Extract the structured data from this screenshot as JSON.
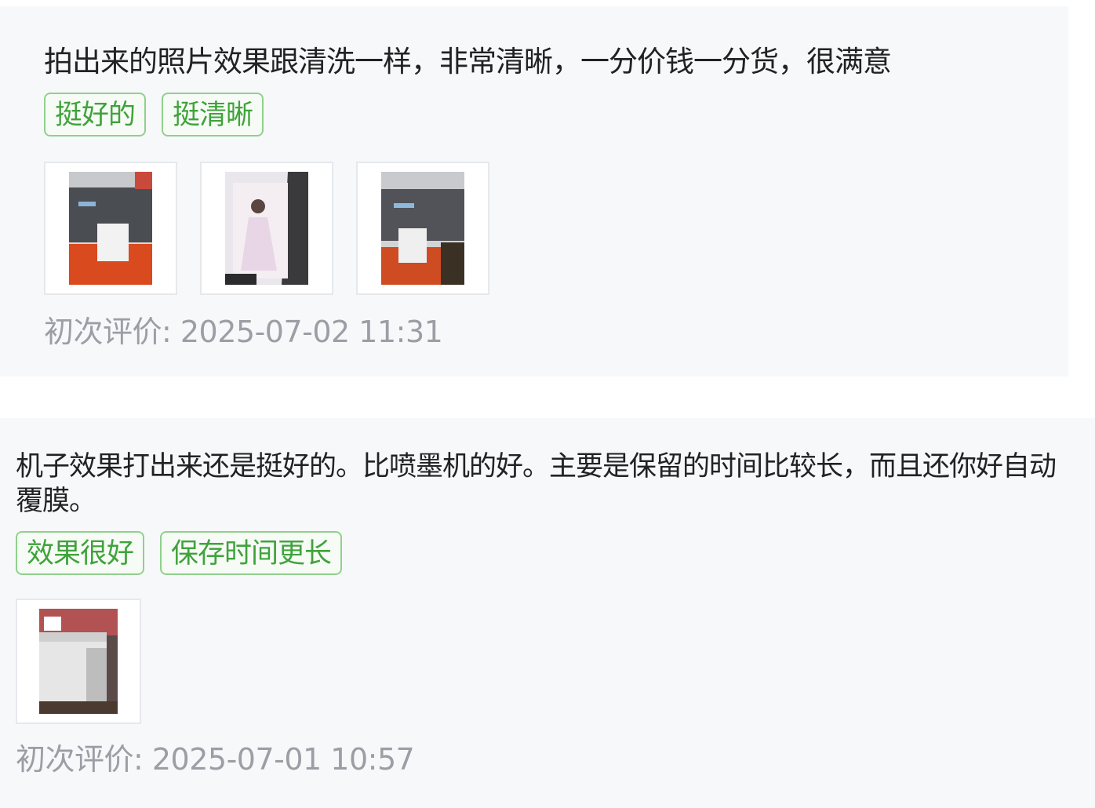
{
  "reviews": [
    {
      "text": "拍出来的照片效果跟清洗一样，非常清晰，一分价钱一分货，很满意",
      "tags": [
        "挺好的",
        "挺清晰"
      ],
      "photo_icons": [
        "printer-photo-icon",
        "portrait-print-photo-icon",
        "printer-photo-icon"
      ],
      "timestamp": "初次评价: 2025-07-02 11:31"
    },
    {
      "text": "机子效果打出来还是挺好的。比喷墨机的好。主要是保留的时间比较长，而且还你好自动覆膜。",
      "tags": [
        "效果很好",
        "保存时间更长"
      ],
      "photo_icons": [
        "printer-photo-icon"
      ],
      "timestamp": "初次评价: 2025-07-01 10:57"
    }
  ],
  "colors": {
    "card_bg": "#f7f8fa",
    "tag_border": "#8fd18c",
    "tag_text": "#3fa33b",
    "body_text": "#222222",
    "meta_text": "#9b9ea5"
  }
}
